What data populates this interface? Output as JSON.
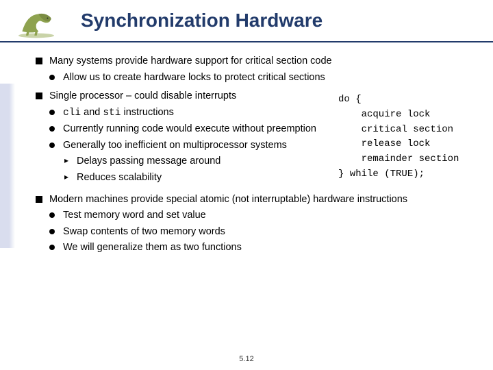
{
  "title": "Synchronization Hardware",
  "pageNumber": "5.12",
  "bullets": {
    "b1": "Many systems provide hardware support for critical section code",
    "b1a": "Allow us to create hardware locks to protect critical sections",
    "b2": "Single processor – could disable interrupts",
    "b2a_pre": "",
    "b2a_code1": "cli",
    "b2a_mid": " and ",
    "b2a_code2": "sti",
    "b2a_post": " instructions",
    "b2b": "Currently running code would execute without preemption",
    "b2c": "Generally too inefficient on multiprocessor systems",
    "b2c1": "Delays passing message around",
    "b2c2": "Reduces scalability",
    "b3": "Modern machines provide special atomic (not interruptable) hardware instructions",
    "b3a": "Test memory word and set value",
    "b3b": "Swap contents of two memory words",
    "b3c": "We will generalize them as two functions"
  },
  "code": "do {\n    acquire lock\n    critical section\n    release lock\n    remainder section\n} while (TRUE);"
}
